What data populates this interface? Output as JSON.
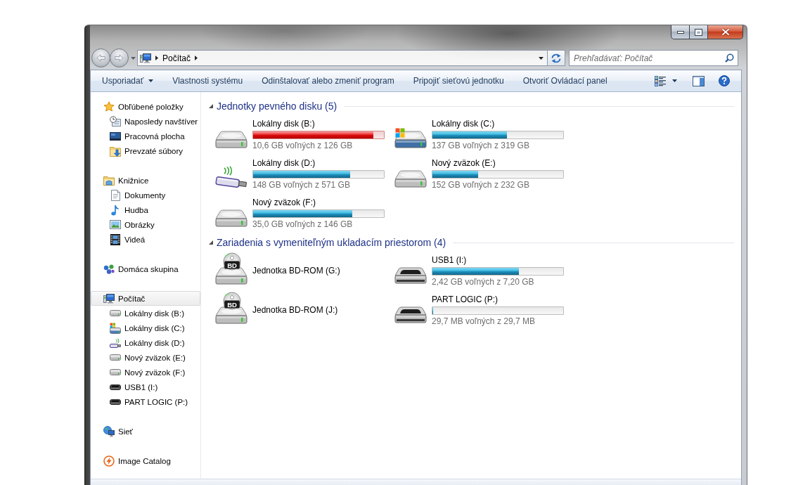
{
  "nav_buttons": [
    {
      "kind": "back",
      "disabled": true
    },
    {
      "kind": "forward",
      "disabled": true
    }
  ],
  "address_bar": {
    "path": [
      {
        "label": "Počítač"
      }
    ]
  },
  "search": {
    "placeholder": "Prehľadávať: Počítač"
  },
  "toolbar": {
    "buttons": [
      {
        "label": "Usporiadať",
        "dropdown": true
      },
      {
        "label": "Vlastnosti systému",
        "dropdown": false
      },
      {
        "label": "Odinštalovať alebo zmeniť program",
        "dropdown": false
      },
      {
        "label": "Pripojiť sieťovú jednotku",
        "dropdown": false
      },
      {
        "label": "Otvoriť Ovládací panel",
        "dropdown": false
      }
    ]
  },
  "sidebar": {
    "groups": [
      {
        "label": "Obľúbené položky",
        "kind": "favorites",
        "selected": false,
        "children": [
          {
            "label": "Naposledy navštíver",
            "kind": "recent",
            "selected": false
          },
          {
            "label": "Pracovná plocha",
            "kind": "desktop",
            "selected": false
          },
          {
            "label": "Prevzaté súbory",
            "kind": "downloads",
            "selected": false
          }
        ]
      },
      {
        "label": "Knižnice",
        "kind": "libraries",
        "selected": false,
        "children": [
          {
            "label": "Dokumenty",
            "kind": "documents",
            "selected": false
          },
          {
            "label": "Hudba",
            "kind": "music",
            "selected": false
          },
          {
            "label": "Obrázky",
            "kind": "pictures",
            "selected": false
          },
          {
            "label": "Videá",
            "kind": "videos",
            "selected": false
          }
        ]
      },
      {
        "label": "Domáca skupina",
        "kind": "homegroup",
        "selected": false
      },
      {
        "label": "Počítač",
        "kind": "computer",
        "selected": true,
        "children": [
          {
            "label": "Lokálny disk (B:)",
            "kind": "hdd",
            "selected": false
          },
          {
            "label": "Lokálny disk (C:)",
            "kind": "system",
            "selected": false
          },
          {
            "label": "Lokálny disk (D:)",
            "kind": "usb",
            "selected": false
          },
          {
            "label": "Nový zväzok (E:)",
            "kind": "hdd",
            "selected": false
          },
          {
            "label": "Nový zväzok (F:)",
            "kind": "hdd",
            "selected": false
          },
          {
            "label": "USB1 (I:)",
            "kind": "removable",
            "selected": false
          },
          {
            "label": "PART LOGIC (P:)",
            "kind": "removable",
            "selected": false
          }
        ]
      },
      {
        "label": "Sieť",
        "kind": "network",
        "selected": false
      },
      {
        "label": "Image Catalog",
        "kind": "app",
        "selected": false
      }
    ]
  },
  "sections": [
    {
      "title": "Jednotky pevného disku (5)",
      "expanded": true,
      "drives": [
        {
          "name": "Lokálny disk (B:)",
          "kind": "hdd",
          "selected": false,
          "level": 0.92,
          "low_space": true,
          "free": "10,6 GB voľných z 126 GB"
        },
        {
          "name": "Lokálny disk (C:)",
          "kind": "system",
          "selected": false,
          "level": 0.57,
          "low_space": false,
          "free": "137 GB voľných z 319 GB"
        },
        {
          "name": "Lokálny disk (D:)",
          "kind": "usb",
          "selected": false,
          "level": 0.74,
          "low_space": false,
          "free": "148 GB voľných z 571 GB"
        },
        {
          "name": "Nový zväzok (E:)",
          "kind": "hdd",
          "selected": false,
          "level": 0.35,
          "low_space": false,
          "free": "152 GB voľných z 232 GB"
        },
        {
          "name": "Nový zväzok (F:)",
          "kind": "hdd",
          "selected": false,
          "level": 0.76,
          "low_space": false,
          "free": "35,0 GB voľných z 146 GB"
        }
      ]
    },
    {
      "title": "Zariadenia s vymeniteľným ukladacím priestorom (4)",
      "expanded": true,
      "drives": [
        {
          "name": "Jednotka BD-ROM (G:)",
          "kind": "optical",
          "selected": false,
          "disc_label": "BD"
        },
        {
          "name": "USB1 (I:)",
          "kind": "removable",
          "selected": false,
          "level": 0.66,
          "low_space": false,
          "free": "2,42 GB voľných z 7,20 GB"
        },
        {
          "name": "Jednotka BD-ROM (J:)",
          "kind": "optical",
          "selected": false,
          "disc_label": "BD"
        },
        {
          "name": "PART LOGIC (P:)",
          "kind": "removable",
          "selected": false,
          "level": 0,
          "low_space": false,
          "free": "29,7 MB voľných z 29,7 MB"
        }
      ]
    }
  ]
}
